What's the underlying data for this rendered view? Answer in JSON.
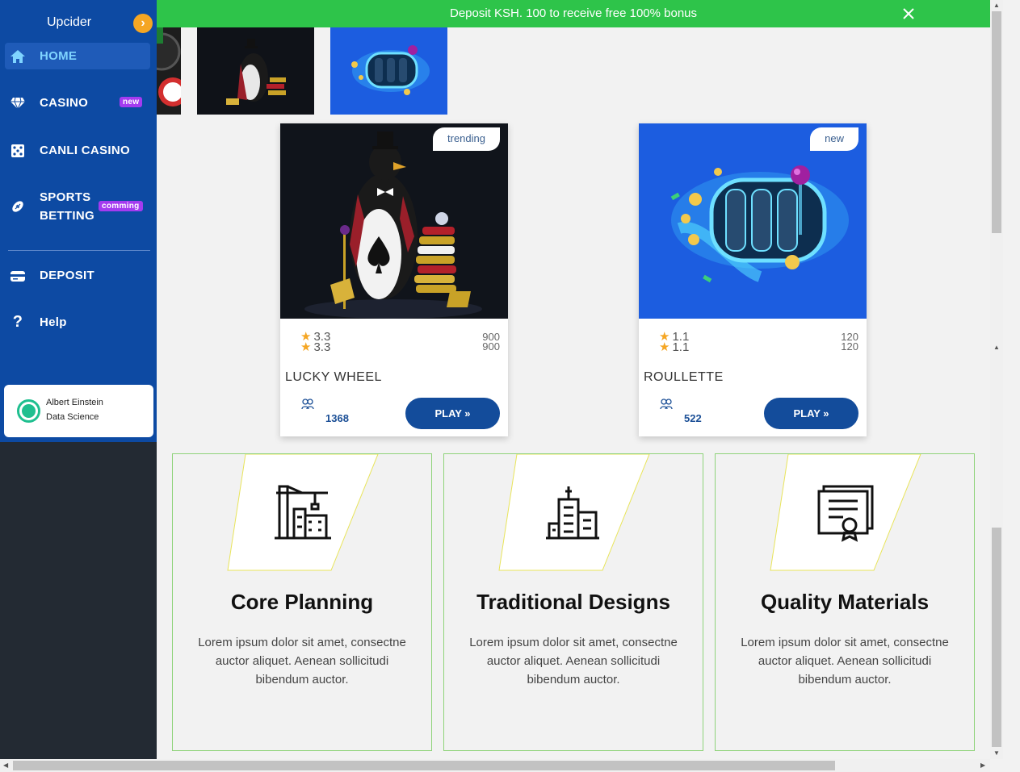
{
  "sidebar": {
    "brand": "Upcider",
    "items": [
      {
        "label": "HOME",
        "icon": "home-icon"
      },
      {
        "label": "CASINO",
        "icon": "diamond-icon",
        "badge": "new"
      },
      {
        "label": "CANLI CASINO",
        "icon": "dice-icon"
      },
      {
        "label_line1": "SPORTS",
        "label_line2": "BETTING",
        "icon": "football-icon",
        "badge": "comming"
      },
      {
        "label": "DEPOSIT",
        "icon": "wallet-icon"
      },
      {
        "label": "Help",
        "icon": "question-icon"
      }
    ],
    "user": {
      "name": "Albert Einstein",
      "role": "Data Science"
    }
  },
  "banner": {
    "text": "Deposit KSH. 100 to receive free 100% bonus"
  },
  "games": [
    {
      "title": "LUCKY WHEEL",
      "tag": "trending",
      "rating": "3.3",
      "score": "900",
      "players": "1368",
      "play_label": "PLAY »"
    },
    {
      "title": "ROULLETTE",
      "tag": "new",
      "rating": "1.1",
      "score": "120",
      "players": "522",
      "play_label": "PLAY »"
    }
  ],
  "features": [
    {
      "title": "Core Planning",
      "desc_line1": "Lorem ipsum dolor sit amet, consectne",
      "desc_line2": "auctor aliquet. Aenean sollicitudi",
      "desc_line3": "bibendum auctor."
    },
    {
      "title": "Traditional Designs",
      "desc_line1": "Lorem ipsum dolor sit amet, consectne",
      "desc_line2": "auctor aliquet. Aenean sollicitudi",
      "desc_line3": "bibendum auctor."
    },
    {
      "title": "Quality Materials",
      "desc_line1": "Lorem ipsum dolor sit amet, consectne",
      "desc_line2": "auctor aliquet. Aenean sollicitudi",
      "desc_line3": "bibendum auctor."
    }
  ],
  "colors": {
    "sidebar_blue": "#0d4aa3",
    "banner_green": "#2ec44a",
    "button_blue": "#134c9b",
    "accent_orange": "#f5a623",
    "badge_purple": "#a43bf0"
  }
}
